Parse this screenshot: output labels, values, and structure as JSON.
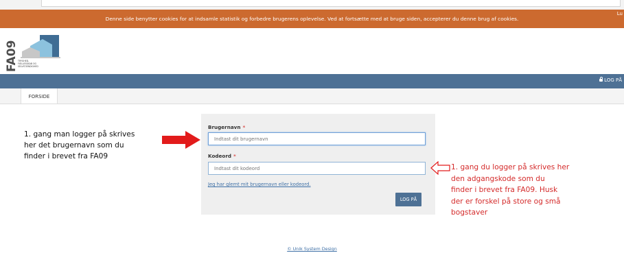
{
  "cookie_banner": {
    "text": "Denne side benytter cookies for at indsamle statistik og forbedre brugerens oplevelse. Ved at fortsætte med at bruge siden, accepterer du denne brug af cookies.",
    "cut_text": "Lu"
  },
  "logo": {
    "wordmark": "FA09",
    "tagline_lines": [
      "TRYGHED,",
      "FÆLLESSKAB OG",
      "SELVSTÆNDIGHED"
    ]
  },
  "navbar": {
    "login_label": "LOG PÅ",
    "lock_icon": "lock-icon"
  },
  "tabs": [
    {
      "label": "FORSIDE",
      "active": true
    }
  ],
  "login_form": {
    "username": {
      "label": "Brugernavn",
      "required_marker": "*",
      "placeholder": "Indtast dit brugernavn",
      "value": ""
    },
    "password": {
      "label": "Kodeord",
      "required_marker": "*",
      "placeholder": "Indtast dit kodeord",
      "value": ""
    },
    "forgot_link": "Jeg har glemt mit brugernavn eller kodeord.",
    "submit_label": "LOG PÅ"
  },
  "annotations": {
    "left_note_lines": [
      "1. gang man logger på skrives",
      "her det brugernavn som du",
      "finder i brevet fra FA09"
    ],
    "right_note_lines": [
      "1. gang du logger på skrives her",
      "den adgangskode som du",
      "finder i brevet fra FA09. Husk",
      "der er forskel på store og små",
      "bogstaver"
    ],
    "left_arrow_color": "#e21b1b",
    "right_arrow_color": "#e21b1b"
  },
  "footer": {
    "link_text": "© Unik System Design"
  },
  "colors": {
    "cookie_bar": "#cc6a2f",
    "navbar": "#4e7195",
    "panel": "#efefef",
    "link": "#3c6ea5",
    "annotation_red": "#d42a2a"
  }
}
